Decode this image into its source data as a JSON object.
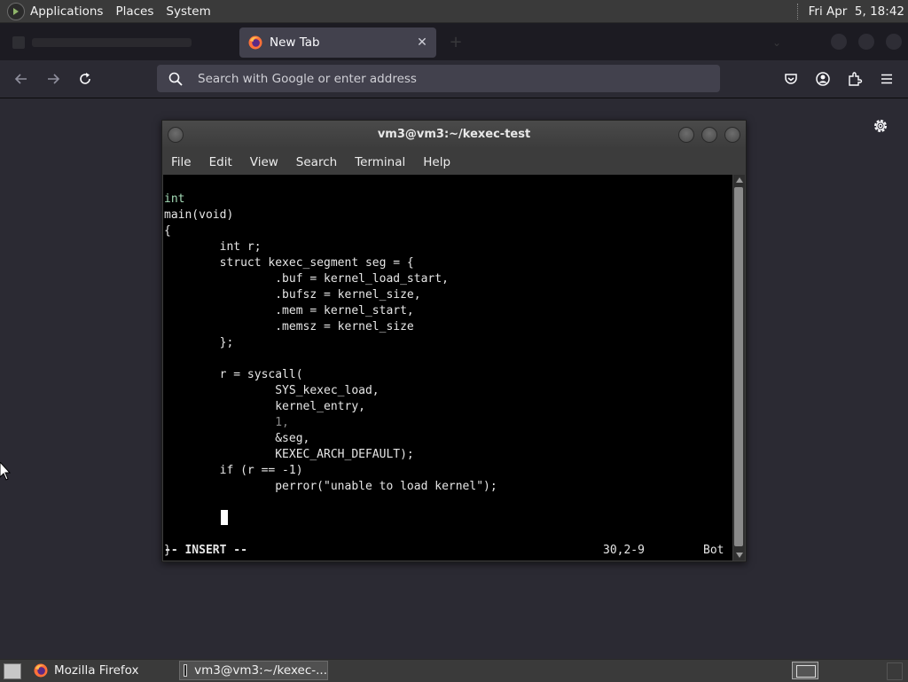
{
  "top_panel": {
    "menus": [
      "Applications",
      "Places",
      "System"
    ],
    "clock": "Fri Apr  5, 18:42"
  },
  "browser": {
    "active_tab": {
      "title": "New Tab",
      "close": "✕"
    },
    "new_tab": "+",
    "url_placeholder": "Search with Google or enter address"
  },
  "terminal": {
    "title": "vm3@vm3:~/kexec-test",
    "menu": [
      "File",
      "Edit",
      "View",
      "Search",
      "Terminal",
      "Help"
    ],
    "code_lines": [
      "int",
      "main(void)",
      "{",
      "        int r;",
      "        struct kexec_segment seg = {",
      "                .buf = kernel_load_start,",
      "                .bufsz = kernel_size,",
      "                .mem = kernel_start,",
      "                .memsz = kernel_size",
      "        };",
      "",
      "        r = syscall(",
      "                SYS_kexec_load,",
      "                kernel_entry,",
      "                1,",
      "                &seg,",
      "                KEXEC_ARCH_DEFAULT);",
      "        if (r == -1)",
      "                perror(\"unable to load kernel\");",
      "",
      "        ",
      "",
      "}"
    ],
    "status": {
      "mode": "-- INSERT --",
      "position": "30,2-9",
      "scroll": "Bot"
    }
  },
  "taskbar": {
    "firefox": "Mozilla Firefox",
    "terminal": "vm3@vm3:~/kexec-..."
  },
  "colors": {
    "firefox_bg": "#2b2a33",
    "firefox_tabbar": "#1c1b22",
    "panel": "#3a3a3a",
    "terminal_bg": "#000000"
  }
}
